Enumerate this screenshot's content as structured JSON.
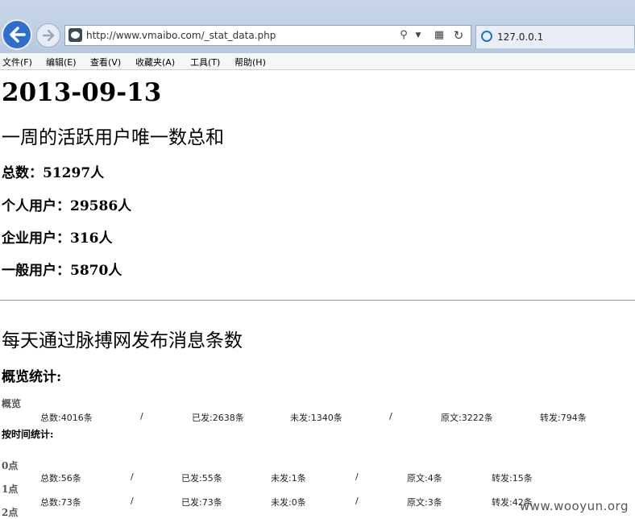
{
  "browser": {
    "url": "http://www.vmaibo.com/_stat_data.php",
    "tab_title": "127.0.0.1",
    "menu": [
      "文件(F)",
      "编辑(E)",
      "查看(V)",
      "收藏夹(A)",
      "工具(T)",
      "帮助(H)"
    ]
  },
  "page": {
    "date": "2013-09-13",
    "weekly_title": "一周的活跃用户唯一数总和",
    "weekly": [
      {
        "label": "总数：",
        "value": "51297人"
      },
      {
        "label": "个人用户：",
        "value": "29586人"
      },
      {
        "label": "企业用户：",
        "value": "316人"
      },
      {
        "label": "一般用户：",
        "value": "5870人"
      }
    ],
    "daily_title": "每天通过脉搏网发布消息条数",
    "overview_heading": "概览统计:",
    "overview": {
      "label": "概览",
      "total": "总数:4016条",
      "sep1": "/",
      "sent": "已发:2638条",
      "unsent": "未发:1340条",
      "sep2": "/",
      "original": "原文:3222条",
      "forward": "转发:794条"
    },
    "by_hour_heading": "按时间统计:",
    "hours": [
      {
        "label": "0点",
        "total": "总数:56条",
        "sep1": "/",
        "sent": "已发:55条",
        "unsent": "未发:1条",
        "sep2": "/",
        "original": "原文:4条",
        "forward": "转发:15条"
      },
      {
        "label": "1点",
        "total": "总数:73条",
        "sep1": "/",
        "sent": "已发:73条",
        "unsent": "未发:0条",
        "sep2": "/",
        "original": "原文:3条",
        "forward": "转发:42条"
      }
    ],
    "partial_label": "2点"
  },
  "watermark": "www.wooyun.org",
  "colors": {
    "back_button": "#2f6fc9",
    "ie_icon": "#1f74c4",
    "chrome_bg": "#c9d6e8"
  }
}
